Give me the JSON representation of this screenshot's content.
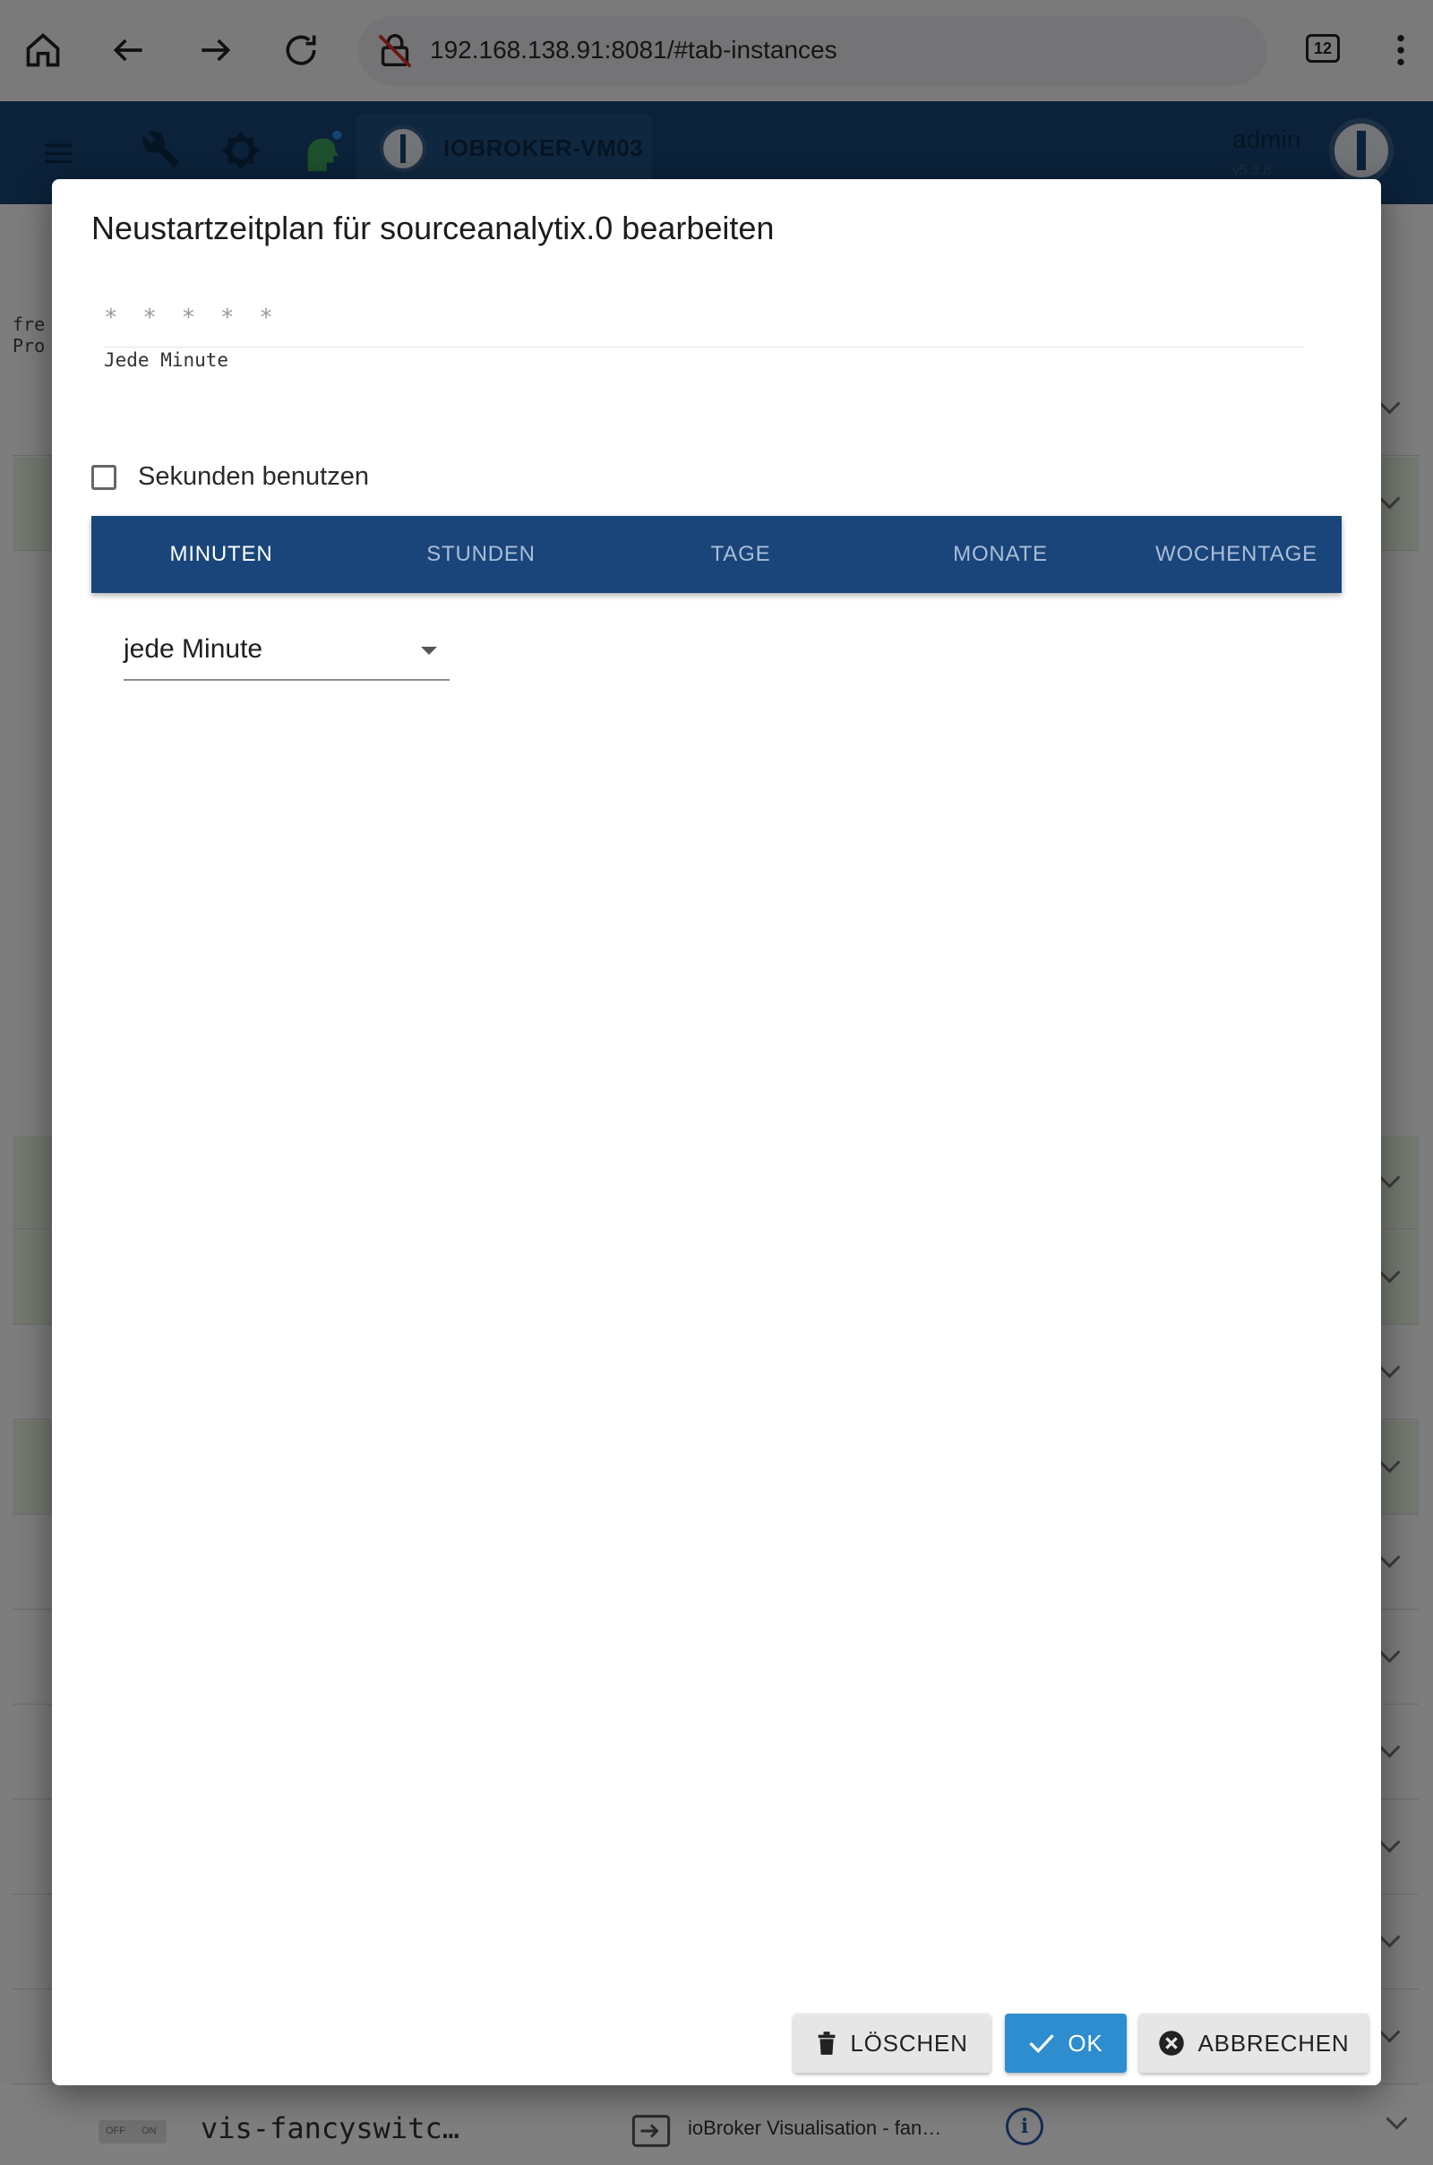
{
  "browser": {
    "url": "192.168.138.91:8081/#tab-instances",
    "tab_count": "12"
  },
  "app": {
    "host_name": "IOBROKER-VM03",
    "user_name": "admin",
    "version": "v5.3.8"
  },
  "background": {
    "side_text_1": "fre",
    "side_text_2": "Pro",
    "bottom_row": {
      "toggle_off": "OFF",
      "toggle_on": "ON",
      "name": "vis-fancyswitc…",
      "description": "ioBroker Visualisation - fan…"
    }
  },
  "dialog": {
    "title": "Neustartzeitplan für sourceanalytix.0 bearbeiten",
    "cron_expression": "* * * * *",
    "cron_description": "Jede Minute",
    "use_seconds_label": "Sekunden benutzen",
    "use_seconds_checked": false,
    "tabs": [
      {
        "label": "MINUTEN",
        "active": true
      },
      {
        "label": "STUNDEN",
        "active": false
      },
      {
        "label": "TAGE",
        "active": false
      },
      {
        "label": "MONATE",
        "active": false
      },
      {
        "label": "WOCHENTAGE",
        "active": false
      }
    ],
    "minutes_select_value": "jede Minute",
    "buttons": {
      "delete": "LÖSCHEN",
      "ok": "OK",
      "cancel": "ABBRECHEN"
    }
  },
  "colors": {
    "header": "#174474",
    "tabbar": "#1a457a",
    "ok_button": "#2d8dcf",
    "row_green": "#e6f3e1"
  },
  "icons": [
    "home-icon",
    "back-icon",
    "forward-icon",
    "reload-icon",
    "not-secure-icon",
    "menu-icon",
    "wrench-icon",
    "brightness-icon",
    "expert-mode-icon",
    "delete-icon",
    "check-icon",
    "cancel-icon",
    "info-icon",
    "link-icon"
  ]
}
